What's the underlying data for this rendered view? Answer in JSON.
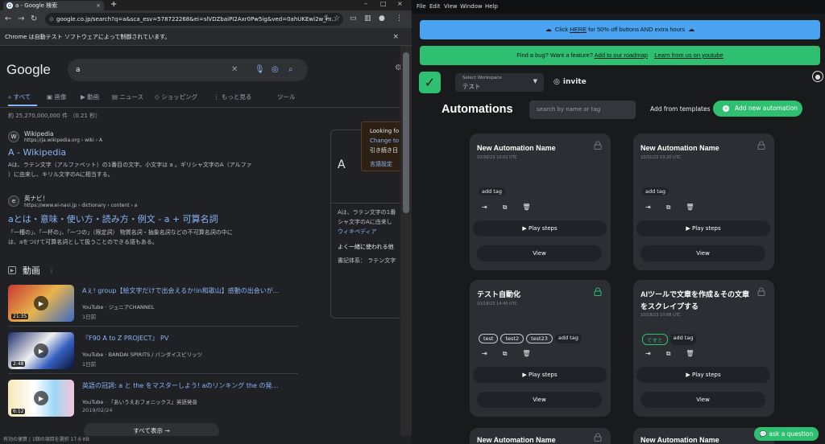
{
  "chrome": {
    "tab_title": "a - Google 検索",
    "new_tab_glyph": "+",
    "url": "google.co.jp/search?q=a&sca_esv=578722268&ei=slVDZbaiPI2Axr0Pw5ig&ved=0ahUKEwi2w_m...",
    "infobar_text": "Chrome は自動テスト ソフトウェアによって制御されています。",
    "infobar_close": "×",
    "status_text": "有効の便算 | 1個の項目を選択 17.6 KB"
  },
  "google": {
    "logo": "Google",
    "query": "a",
    "tabs": [
      "すべて",
      "画像",
      "動画",
      "ニュース",
      "ショッピング",
      "もっと見る",
      "ツール"
    ],
    "stats": "約 25,270,000,000 件 （0.21 秒）",
    "results": [
      {
        "site": "Wikipedia",
        "url": "https://ja.wikipedia.org › wiki › A",
        "title": "A - Wikipedia",
        "snippet1": "Aは、ラテン文字（アルファベット）の1番目の文字。小文字は a 。ギリシャ文字のΑ（アルファ",
        "snippet2": "）に由来し、キリル文字のАに相当する。"
      },
      {
        "site": "英ナビ！",
        "url": "https://www.ei-navi.jp › dictionary › content › a",
        "title": "aとは・意味・使い方・読み方・例文 - a + 可算名詞",
        "snippet1": "「一種の」、「一杯の」、「一つの」（限定詞） 物質名詞・抽象名詞などの不可算名詞の中に",
        "snippet2": "は、aをつけて可算名詞として扱うことのできる語もある。"
      }
    ],
    "knowledge_panel": {
      "letter": "A",
      "line1": "Aは、ラテン文字の1番",
      "line2": "シャ文字のΑに由来し",
      "link": "ウィキペディア",
      "related": "よく一緒に使われる他",
      "typeface": "書記体系： ラテン文字"
    },
    "popup": {
      "line1": "Looking fo",
      "line2": "Change to E",
      "line3": "引き続き日",
      "line4": "言語設定"
    },
    "videos_heading": "動画",
    "videos": [
      {
        "title": "Aぇ! group【絵文字だけで出会えるか!in和歌山】感動の出会いが…",
        "source": "YouTube · ジュニアCHANNEL",
        "date": "1日前",
        "duration": "21:35"
      },
      {
        "title": "『F90 A to Z PROJECT』 PV",
        "source": "YouTube · BANDAI SPIRITS / バンダイスピリッツ",
        "date": "1日前",
        "duration": "2:48"
      },
      {
        "title": "英語の冠詞: a と the をマスターしよう! aのリンキング the の発…",
        "source": "YouTube · 『あいうえおフォニックス』英語発音",
        "date": "2019/02/24",
        "duration": "6:12"
      }
    ],
    "show_all": "すべて表示 →"
  },
  "app": {
    "menu": [
      "File",
      "Edit",
      "View",
      "Window",
      "Help"
    ],
    "promo_prefix": "Click ",
    "promo_link": "HERE",
    "promo_suffix": " for 50% off buttons AND extra hours",
    "bug_text": "Find a bug? Want a feature? ",
    "bug_link1": "Add to our roadmap",
    "bug_link2": "Learn from us on youtube",
    "workspace_label": "Select Workspace",
    "workspace_value": "テスト",
    "invite": "invite",
    "title": "Automations",
    "search_placeholder": "search by name or tag",
    "from_templates": "Add from templates",
    "add_new": "Add new automation",
    "play_steps": "Play steps",
    "view": "View",
    "add_tag": "add tag",
    "ask": "ask a question",
    "cards": [
      {
        "title": "New Automation Name",
        "date": "10/30/23 10:02 UTC",
        "tags": [],
        "locked": true
      },
      {
        "title": "New Automation Name",
        "date": "10/31/23 10:20 UTC",
        "tags": [],
        "locked": true
      },
      {
        "title": "テスト自動化",
        "date": "10/18/23 14:45 UTC",
        "tags": [
          "test",
          "test2",
          "test23"
        ],
        "locked": false
      },
      {
        "title": "AIツールで文章を作成＆その文章をスクレイプする",
        "date": "10/18/23 10:08 UTC",
        "tags": [
          "てすと"
        ],
        "locked": true
      },
      {
        "title": "New Automation Name",
        "date": "",
        "tags": [],
        "locked": true
      },
      {
        "title": "New Automation Name",
        "date": "",
        "tags": [],
        "locked": true
      }
    ]
  },
  "colors": {
    "accent_green": "#2fbf71",
    "promo_blue": "#4aa3f0",
    "google_link": "#8ab4f8",
    "page_bg": "#202124",
    "app_bg": "#181a1c"
  }
}
